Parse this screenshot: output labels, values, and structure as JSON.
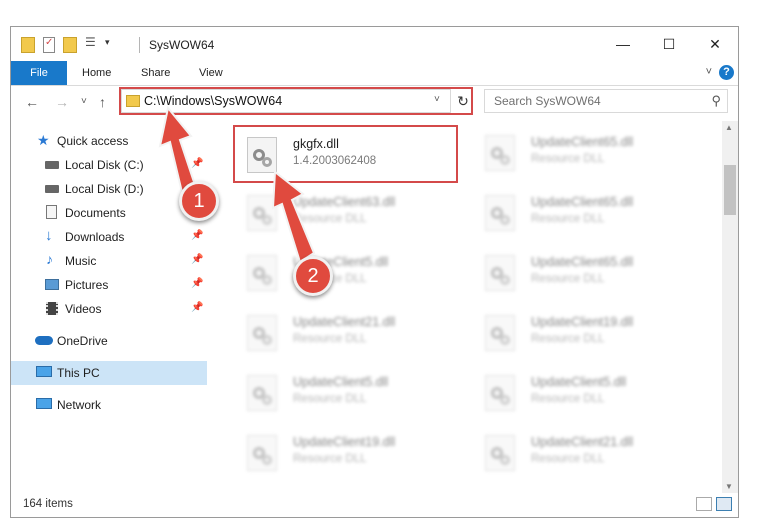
{
  "window": {
    "title": "SysWOW64",
    "minimize_glyph": "—",
    "maximize_glyph": "☐",
    "close_glyph": "✕"
  },
  "ribbon": {
    "tabs": [
      {
        "label": "File"
      },
      {
        "label": "Home"
      },
      {
        "label": "Share"
      },
      {
        "label": "View"
      }
    ],
    "help_glyph": "?",
    "collapse_glyph": "˅"
  },
  "navigation": {
    "back_glyph": "←",
    "forward_glyph": "→",
    "recent_glyph": "˅",
    "up_glyph": "↑",
    "address_path": "C:\\Windows\\SysWOW64",
    "address_dropdown_glyph": "˅",
    "refresh_glyph": "↻",
    "search_placeholder": "Search SysWOW64",
    "search_glyph": "⚲"
  },
  "sidebar": {
    "items": [
      {
        "label": "Quick access",
        "icon": "star-icon",
        "pinned": false
      },
      {
        "label": "Local Disk (C:)",
        "icon": "drive-icon",
        "pinned": true
      },
      {
        "label": "Local Disk (D:)",
        "icon": "drive-icon",
        "pinned": false
      },
      {
        "label": "Documents",
        "icon": "documents-icon",
        "pinned": true
      },
      {
        "label": "Downloads",
        "icon": "download-icon",
        "pinned": true
      },
      {
        "label": "Music",
        "icon": "music-icon",
        "pinned": true
      },
      {
        "label": "Pictures",
        "icon": "pictures-icon",
        "pinned": true
      },
      {
        "label": "Videos",
        "icon": "videos-icon",
        "pinned": true
      },
      {
        "label": "OneDrive",
        "icon": "cloud-icon",
        "pinned": false
      },
      {
        "label": "This PC",
        "icon": "computer-icon",
        "pinned": false,
        "selected": true
      },
      {
        "label": "Network",
        "icon": "network-icon",
        "pinned": false
      }
    ],
    "pin_glyph": "📌"
  },
  "files": {
    "highlighted": {
      "name": "gkgfx.dll",
      "description": "1.4.2003062408"
    },
    "left_column": [
      {
        "name": "UpdateClient63.dll",
        "description": "Resource DLL"
      },
      {
        "name": "UpdateClient5.dll",
        "description": "Resource DLL"
      },
      {
        "name": "UpdateClient21.dll",
        "description": "Resource DLL"
      },
      {
        "name": "UpdateClient5.dll",
        "description": "Resource DLL"
      },
      {
        "name": "UpdateClient19.dll",
        "description": "Resource DLL"
      }
    ],
    "right_column": [
      {
        "name": "UpdateClient65.dll",
        "description": "Resource DLL"
      },
      {
        "name": "UpdateClient65.dll",
        "description": "Resource DLL"
      },
      {
        "name": "UpdateClient65.dll",
        "description": "Resource DLL"
      },
      {
        "name": "UpdateClient19.dll",
        "description": "Resource DLL"
      },
      {
        "name": "UpdateClient5.dll",
        "description": "Resource DLL"
      },
      {
        "name": "UpdateClient21.dll",
        "description": "Resource DLL"
      }
    ]
  },
  "status": {
    "item_count": "164 items"
  },
  "annotations": {
    "badge_1": "1",
    "badge_2": "2",
    "color": "#d44a4a"
  }
}
